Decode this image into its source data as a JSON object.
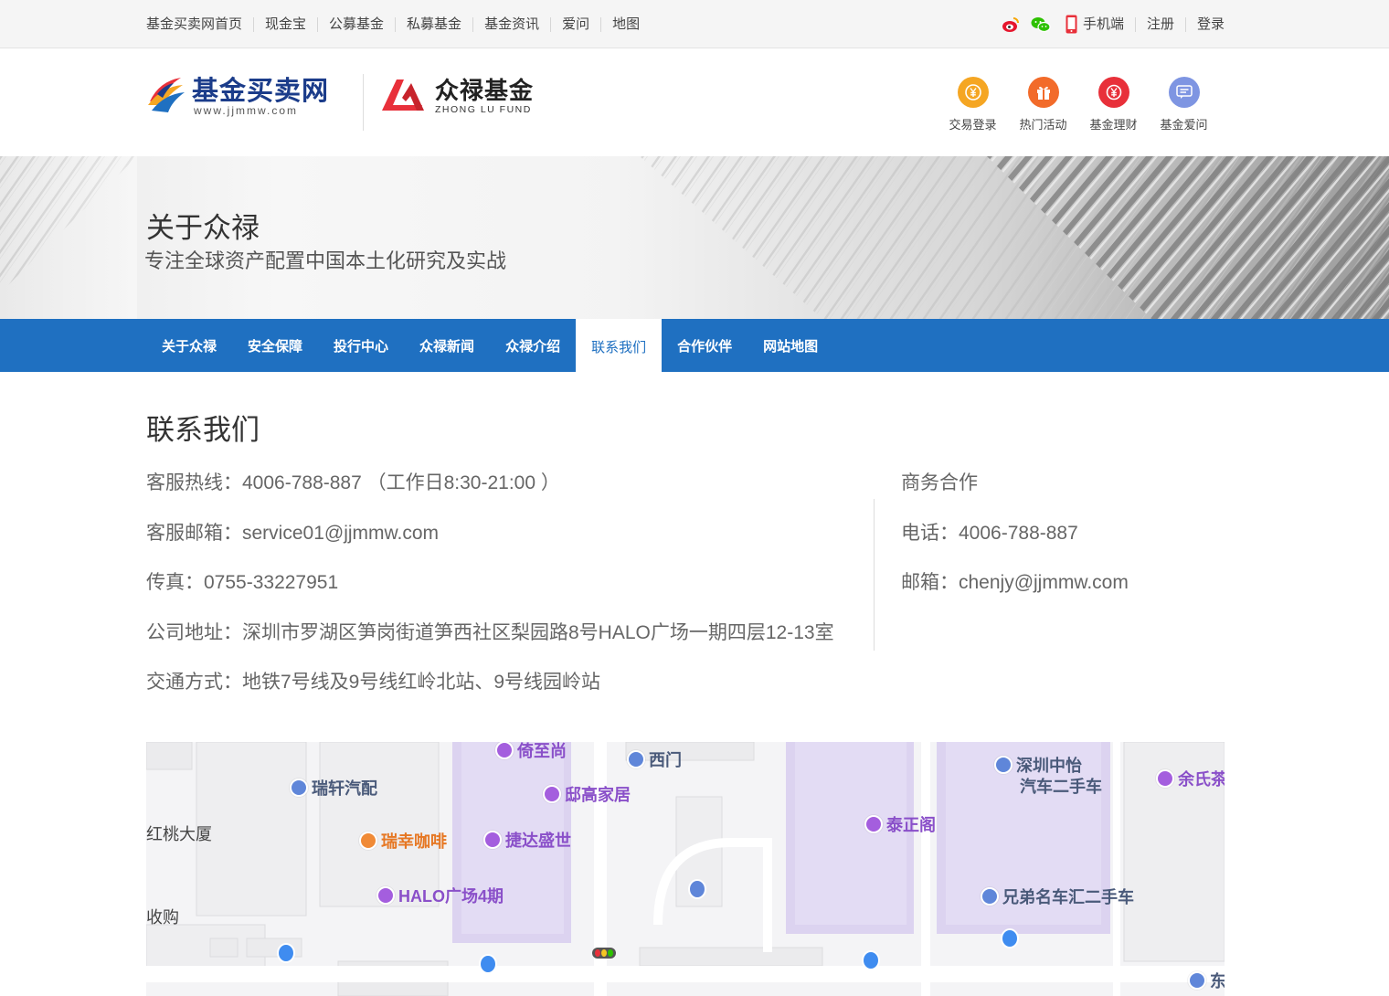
{
  "topnav": {
    "links": [
      "基金买卖网首页",
      "现金宝",
      "公募基金",
      "私募基金",
      "基金资讯",
      "爱问",
      "地图"
    ],
    "mobile": "手机端",
    "register": "注册",
    "login": "登录"
  },
  "header": {
    "logo1_cn": "基金买卖网",
    "logo1_en": "www.jjmmw.com",
    "logo2_cn": "众禄基金",
    "logo2_en": "ZHONG LU FUND",
    "quick_links": [
      {
        "label": "交易登录",
        "icon": "yuan-coin-icon",
        "color": "#f5a623"
      },
      {
        "label": "热门活动",
        "icon": "gift-icon",
        "color": "#f26b2a"
      },
      {
        "label": "基金理财",
        "icon": "money-bag-icon",
        "color": "#e8303a"
      },
      {
        "label": "基金爱问",
        "icon": "chat-bubble-icon",
        "color": "#7e95e2"
      }
    ]
  },
  "banner": {
    "title": "关于众禄",
    "subtitle": "专注全球资产配置中国本土化研究及实战"
  },
  "mainnav": {
    "items": [
      "关于众禄",
      "安全保障",
      "投行中心",
      "众禄新闻",
      "众禄介绍",
      "联系我们",
      "合作伙伴",
      "网站地图"
    ],
    "active": "联系我们"
  },
  "contact": {
    "title": "联系我们",
    "left": [
      "客服热线：4006-788-887 （工作日8:30-21:00 ）",
      "客服邮箱：service01@jjmmw.com",
      "传真：0755-33227951",
      "公司地址：深圳市罗湖区笋岗街道笋西社区梨园路8号HALO广场一期四层12-13室",
      "交通方式：地铁7号线及9号线红岭北站、9号线园岭站"
    ],
    "right": [
      "商务合作",
      "电话：4006-788-887",
      "邮箱：chenjy@jjmmw.com"
    ]
  },
  "map": {
    "pois": [
      "倚至尚",
      "西门",
      "深圳中怡",
      "汽车二手车",
      "余氏茶",
      "瑞轩汽配",
      "邸高家居",
      "红桃大厦",
      "瑞幸咖啡",
      "捷达盛世",
      "泰正阁",
      "HALO广场4期",
      "兄弟名车汇二手车",
      "收购",
      "东"
    ]
  },
  "colors": {
    "nav_blue": "#1f70c1",
    "map_purple": "#dcd3f0",
    "weibo_red": "#e6162d",
    "wechat_green": "#2dc100"
  }
}
